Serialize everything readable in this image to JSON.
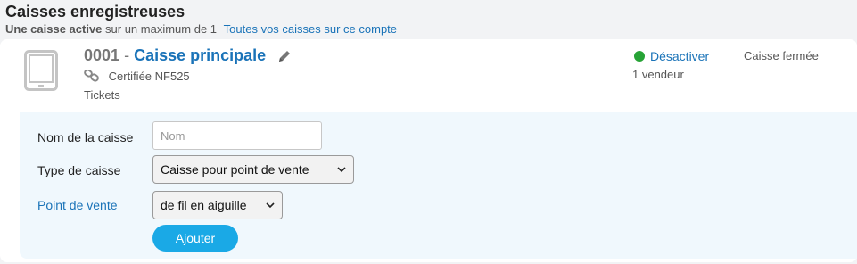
{
  "header": {
    "title": "Caisses enregistreuses",
    "active_count_bold": "Une caisse active",
    "active_limit": "sur un maximum de 1",
    "all_registers_link": "Toutes vos caisses sur ce compte"
  },
  "register": {
    "number": "0001",
    "separator": "-",
    "name": "Caisse principale",
    "certification": "Certifiée NF525",
    "tickets": "Tickets",
    "status_action": "Désactiver",
    "vendors": "1 vendeur",
    "state": "Caisse fermée",
    "icons": {
      "device": "tablet-icon",
      "edit": "pencil-icon",
      "certification": "link-icon",
      "status": "green-dot-icon"
    },
    "colors": {
      "name": "#1a73b8",
      "status_dot": "#27a336"
    }
  },
  "form": {
    "name_label": "Nom de la caisse",
    "name_placeholder": "Nom",
    "name_value": "",
    "type_label": "Type de caisse",
    "type_selected": "Caisse pour point de vente",
    "pos_label": "Point de vente",
    "pos_selected": "de fil en aiguille",
    "add_button": "Ajouter",
    "colors": {
      "panel_background": "#f0f8fd",
      "button": "#1aa9e6"
    }
  }
}
